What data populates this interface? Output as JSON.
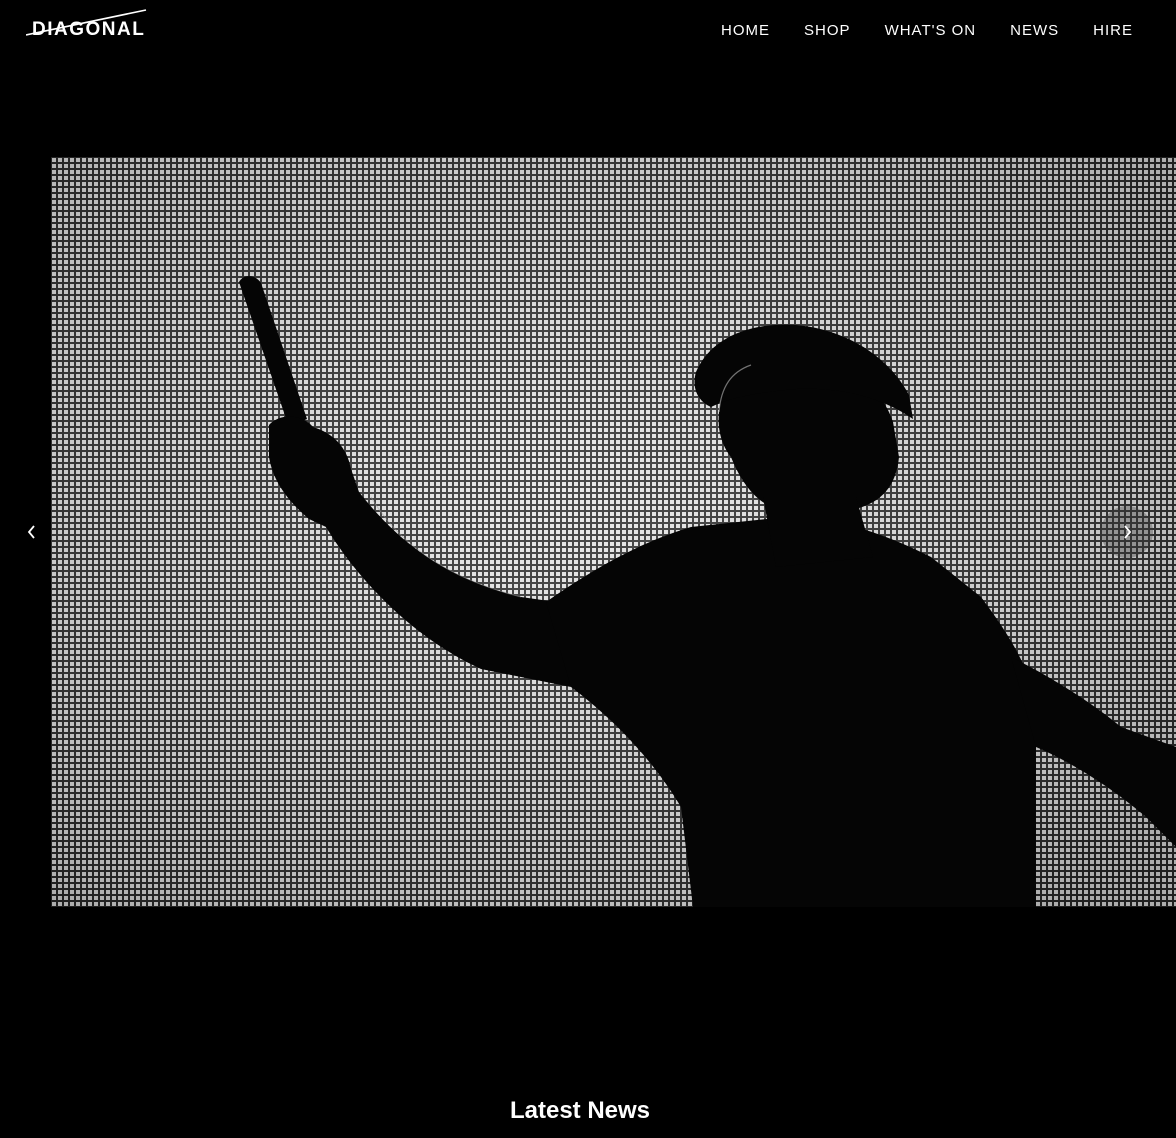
{
  "header": {
    "logo_text": "DIAGONAL",
    "nav": [
      {
        "label": "HOME"
      },
      {
        "label": "SHOP"
      },
      {
        "label": "WHAT'S ON"
      },
      {
        "label": "NEWS"
      },
      {
        "label": "HIRE"
      }
    ]
  },
  "slider": {
    "prev_icon": "chevron-left-icon",
    "next_icon": "chevron-right-icon"
  },
  "latest_news": {
    "title": "Latest News"
  },
  "colors": {
    "background": "#000000",
    "text": "#ffffff"
  }
}
